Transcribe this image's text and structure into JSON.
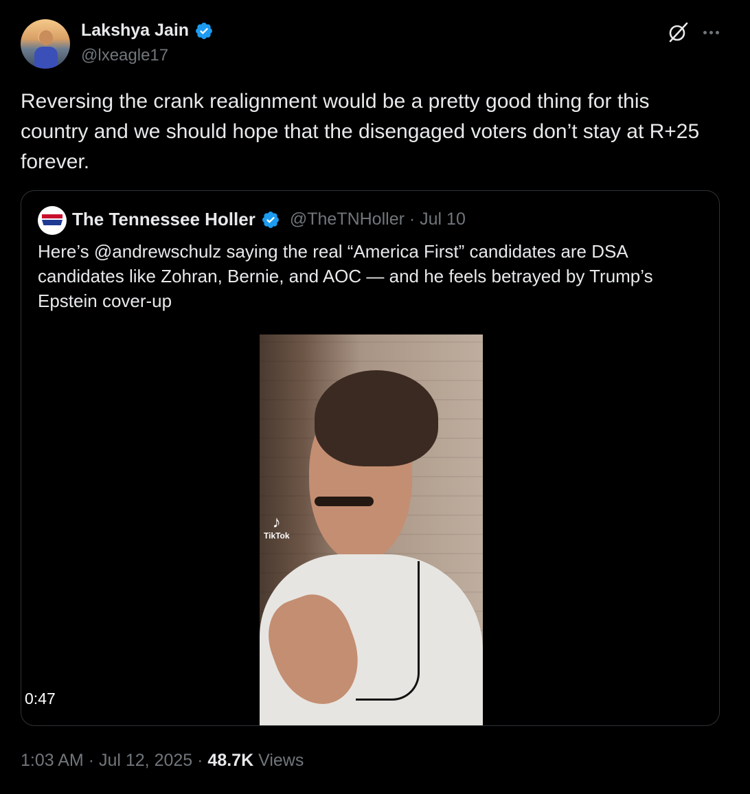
{
  "author": {
    "display_name": "Lakshya Jain",
    "handle": "@lxeagle17"
  },
  "tweet": {
    "text": "Reversing the crank realignment would be a pretty good thing for this country and we should hope that the disengaged voters don’t stay at R+25 forever."
  },
  "quoted": {
    "display_name": "The Tennessee Holler",
    "handle": "@TheTNHoller",
    "separator": "·",
    "date": "Jul 10",
    "text": "Here’s @andrewschulz saying the real “America First” candidates are DSA candidates like Zohran, Bernie, and AOC — and he feels betrayed by Trump’s Epstein cover-up",
    "avatar_text": "TN HOLLER",
    "video": {
      "duration": "0:47",
      "watermark": "TikTok"
    }
  },
  "footer": {
    "time": "1:03 AM",
    "sep1": "·",
    "date": "Jul 12, 2025",
    "sep2": "·",
    "views_count": "48.7K",
    "views_label": "Views"
  },
  "colors": {
    "background": "#000000",
    "text": "#e7e9ea",
    "muted": "#71767b",
    "verified": "#1d9bf0",
    "border": "#2f3336"
  },
  "icons": {
    "verified": "verified-badge-icon",
    "grok": "grok-icon",
    "more": "more-icon"
  }
}
